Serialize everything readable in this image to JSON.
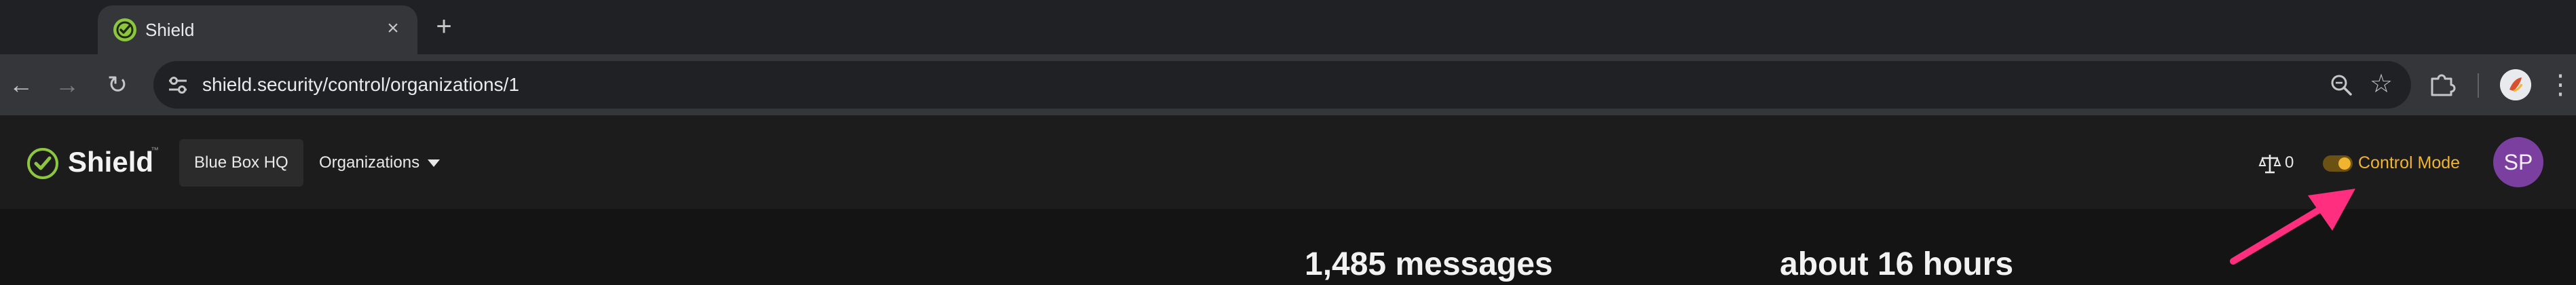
{
  "browser": {
    "tab": {
      "title": "Shield",
      "close_icon": "close-icon"
    },
    "new_tab_label": "+",
    "address": {
      "url": "shield.security/control/organizations/1"
    },
    "colors": {
      "tabstrip": "#202124",
      "toolbar": "#35363a",
      "omnibox": "#202124"
    }
  },
  "app": {
    "logo_text": "Shield",
    "logo_tm": "™",
    "org_chip": "Blue Box HQ",
    "org_menu": "Organizations",
    "scale_count": "0",
    "control_mode_label": "Control Mode",
    "control_mode_on": true,
    "avatar_initials": "SP",
    "colors": {
      "accent": "#f0b431",
      "avatar": "#7b3fa0",
      "brand_green": "#8dc63f",
      "annotation": "#ff2e7e"
    }
  },
  "stats": {
    "messages": "1,485 messages",
    "time": "about 16 hours"
  }
}
